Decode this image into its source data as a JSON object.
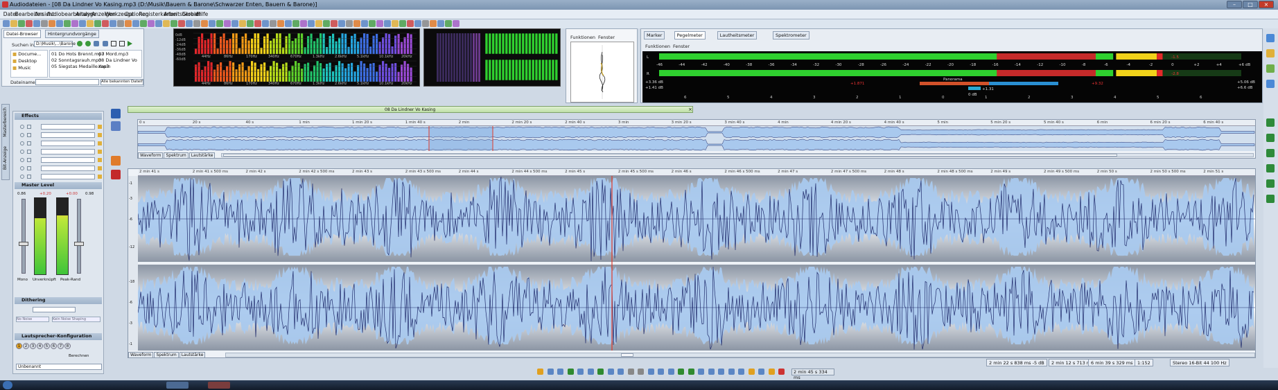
{
  "window": {
    "title": "Audiodateien - [08 Da Lindner Vo Kasing.mp3 (D:\\Musik\\Bauern & Barone\\Schwarzer Enten, Bauern & Barone)]"
  },
  "menu": [
    "Datei",
    "Bearbeiten",
    "Ansicht",
    "Audiobearbeitung",
    "Analyse",
    "Anzeigen",
    "Werkzeuge",
    "Optionen",
    "Registerkarten",
    "Arbeitsbereich",
    "Global",
    "Hilfe"
  ],
  "browser": {
    "tabs": [
      "Datei-Browser",
      "Hintergrundvorgänge"
    ],
    "search_label": "Suchen in:",
    "path": "D:\\Musik\\...\\Barone",
    "folders": [
      "Docume...",
      "Desktop",
      "Music"
    ],
    "files_col1": [
      "01 Do Hots Brennt.mp3",
      "02 Sonntagsrauh.mp3",
      "05 Siegstas Medaille.mp3"
    ],
    "files_col2": [
      "07 Mord.mp3",
      "08 Da Lindner Vo Kasin"
    ],
    "filename_label": "Dateiname:",
    "filter": "Alle bekannten Dateiformate"
  },
  "spectrum": {
    "freq_labels": [
      "44Hz",
      "86Hz",
      "170Hz",
      "340Hz",
      "670Hz",
      "1.3kHz",
      "2.6kHz",
      "5.1kHz",
      "10.1kHz",
      "20kHz"
    ],
    "db_labels": [
      "0dB",
      "-12dB",
      "-24dB",
      "-36dB",
      "-48dB",
      "-60dB"
    ]
  },
  "phase": {
    "menu": [
      "Funktionen",
      "Fenster"
    ]
  },
  "meters_panel": {
    "tabs": [
      "Marker",
      "Pegelmeter",
      "Lautheitsmeter",
      "Spektrometer"
    ],
    "menu": [
      "Funktionen",
      "Fenster"
    ],
    "scale": [
      "-46",
      "-44",
      "-42",
      "-40",
      "-38",
      "-36",
      "-34",
      "-32",
      "-30",
      "-28",
      "-26",
      "-24",
      "-22",
      "-20",
      "-18",
      "-16",
      "-14",
      "-12",
      "-10",
      "-8",
      "-6",
      "-4",
      "-2",
      "0",
      "+2",
      "+4",
      "+6 dB"
    ],
    "left_readout": "+3.36 dB",
    "right_readout": "+1.41 dB",
    "l_val": "-1.5",
    "r_val": "-2.8",
    "rms_l": "+5.06 dB",
    "rms_r": "+6.6 dB",
    "panorama_label": "Panorama",
    "panorama_zero": "0 dB",
    "pan_left": "+1.871",
    "pan_right": "+9.32",
    "pan_center": "+1.31",
    "pan_scale": [
      "6",
      "5",
      "4",
      "3",
      "2",
      "1",
      "0",
      "1",
      "2",
      "3",
      "4",
      "5",
      "6"
    ]
  },
  "side_tabs": [
    "Masterbereich",
    "Bit-Anzeige"
  ],
  "effects": {
    "title": "Effects",
    "slots": [
      "",
      "",
      "",
      "",
      "",
      "",
      ""
    ],
    "master_title": "Master Level",
    "ml_vals": [
      "0.86",
      "+0.20",
      "+0.00",
      "0.98"
    ],
    "ml_labels": [
      "Mono",
      "Unverknüpft",
      "Peak-Rand"
    ],
    "dither_title": "Dithering",
    "dither_opts": [
      "No Noise",
      "Kein Noise Shaping"
    ],
    "speaker_title": "Lautsprecher-Konfiguration",
    "speaker_nums": [
      "1",
      "2",
      "3",
      "4",
      "5",
      "6",
      "7",
      "8"
    ],
    "speaker_btn": "Berechnen",
    "status": "Unbenannt"
  },
  "file_tab": "08 Da Lindner Vo Kasing",
  "overview_ticks": [
    "0 s",
    "20 s",
    "40 s",
    "1 min",
    "1 min 20 s",
    "1 min 40 s",
    "2 min",
    "2 min 20 s",
    "2 min 40 s",
    "3 min",
    "3 min 20 s",
    "3 min 40 s",
    "4 min",
    "4 min 20 s",
    "4 min 40 s",
    "5 min",
    "5 min 20 s",
    "5 min 40 s",
    "6 min",
    "6 min 20 s",
    "6 min 40 s"
  ],
  "detail_ticks": [
    "2 min 41 s",
    "2 min 41 s 500 ms",
    "2 min 42 s",
    "2 min 42 s 500 ms",
    "2 min 43 s",
    "2 min 43 s 500 ms",
    "2 min 44 s",
    "2 min 44 s 500 ms",
    "2 min 45 s",
    "2 min 45 s 500 ms",
    "2 min 46 s",
    "2 min 46 s 500 ms",
    "2 min 47 s",
    "2 min 47 s 500 ms",
    "2 min 48 s",
    "2 min 48 s 500 ms",
    "2 min 49 s",
    "2 min 49 s 500 ms",
    "2 min 50 s",
    "2 min 50 s 500 ms",
    "2 min 51 s"
  ],
  "view_tabs": [
    "Waveform",
    "Spektrum",
    "Lautstärke"
  ],
  "db_scale": [
    "-1",
    "-3",
    "-6",
    "-12",
    "-18",
    "-6",
    "-3",
    "-1"
  ],
  "transport": {
    "position": "2 min 45 s 334 ms"
  },
  "status_bar": {
    "sel_start": "2 min 22 s 838 ms",
    "sel_db": "-5 dB",
    "view_len": "2 min 12 s 713 ms",
    "total": "6 min 39 s 329 ms",
    "zoom": "1:152",
    "format": "Stereo 16-Bit 44 100 Hz"
  },
  "colors": {
    "wave_fill": "#a9c9ee",
    "wave_line": "#1f2a6b",
    "cursor": "#e03a2a",
    "accent": "#3a78c8"
  }
}
